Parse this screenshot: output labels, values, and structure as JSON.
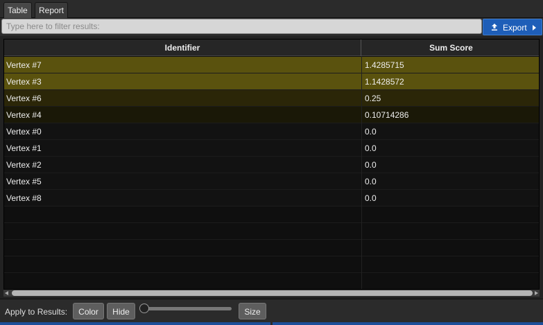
{
  "tabs": [
    {
      "label": "Table",
      "active": true
    },
    {
      "label": "Report",
      "active": false
    }
  ],
  "filter": {
    "value": "",
    "placeholder": "Type here to filter results:"
  },
  "export": {
    "label": "Export",
    "icon": "upload-icon"
  },
  "table": {
    "columns": [
      "Identifier",
      "Sum Score"
    ],
    "rows": [
      {
        "identifier": "Vertex #7",
        "score": "1.4285715",
        "highlight": "#5a520e"
      },
      {
        "identifier": "Vertex #3",
        "score": "1.1428572",
        "highlight": "#5a520e"
      },
      {
        "identifier": "Vertex #6",
        "score": "0.25",
        "highlight": "#2b2608"
      },
      {
        "identifier": "Vertex #4",
        "score": "0.10714286",
        "highlight": "#1a1807"
      },
      {
        "identifier": "Vertex #0",
        "score": "0.0",
        "highlight": "#121212"
      },
      {
        "identifier": "Vertex #1",
        "score": "0.0",
        "highlight": "#121212"
      },
      {
        "identifier": "Vertex #2",
        "score": "0.0",
        "highlight": "#121212"
      },
      {
        "identifier": "Vertex #5",
        "score": "0.0",
        "highlight": "#121212"
      },
      {
        "identifier": "Vertex #8",
        "score": "0.0",
        "highlight": "#121212"
      }
    ]
  },
  "bottom": {
    "apply_label": "Apply to Results:",
    "color_label": "Color",
    "hide_label": "Hide",
    "size_label": "Size"
  }
}
